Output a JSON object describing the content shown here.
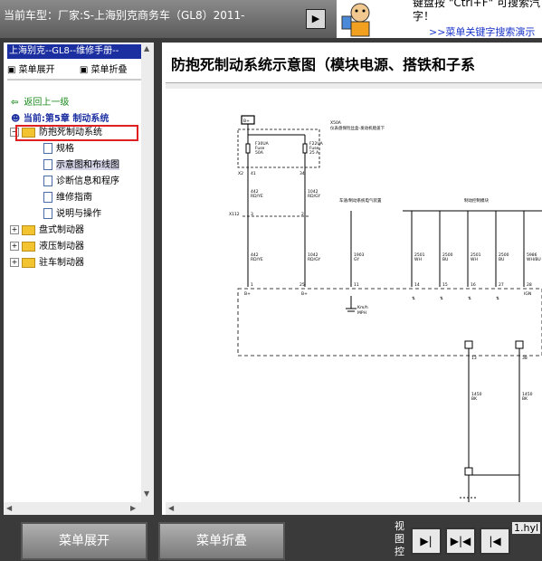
{
  "topbar": {
    "vehicle_label": "当前车型：厂家:S-上海别克商务车（GL8）2011-",
    "nav_button_icon": "play-arrow-icon",
    "ad_hint_line1": "键盘按 \"Ctrl+F\" 可搜索汽",
    "ad_hint_line2": "字！",
    "ad_link": ">>菜单关键字搜索演示"
  },
  "left_panel": {
    "title": "上海别克--GL8--维修手册--",
    "expand_menu": "菜单展开",
    "collapse_menu": "菜单折叠",
    "back_label": "返回上一级",
    "current_label": "当前:第5章  制动系统",
    "tree": [
      {
        "label": "防抱死制动系统",
        "type": "folder",
        "expanded": true
      },
      {
        "label": "规格",
        "type": "doc"
      },
      {
        "label": "示意图和布线图",
        "type": "doc",
        "selected": true
      },
      {
        "label": "诊断信息和程序",
        "type": "doc"
      },
      {
        "label": "维修指南",
        "type": "doc"
      },
      {
        "label": "说明与操作",
        "type": "doc"
      },
      {
        "label": "盘式制动器",
        "type": "folder"
      },
      {
        "label": "液压制动器",
        "type": "folder"
      },
      {
        "label": "驻车制动器",
        "type": "folder"
      }
    ]
  },
  "diagram": {
    "title": "防抱死制动系统示意图（模块电源、搭铁和子系",
    "labels": {
      "bplus": "B+",
      "x50a": "X50A",
      "fuse_block": "仪表盘保险丝盒-发动机舱盖下",
      "f30ua": "F30UA",
      "fuse1": "Fuse",
      "amp1": "50A",
      "f22ua": "F22UA",
      "fuse2": "Fuse",
      "amp2": "25 A",
      "x2": "X2",
      "p41": "41",
      "p34": "34",
      "w442": "442",
      "rdye": "RD/YE",
      "w1042": "1042",
      "rdgy": "RD/GY",
      "x112": "X112",
      "p3": "3",
      "p2": "2",
      "speed_sensor": "车速/制动系统电气装置",
      "module": "制动控制模块",
      "w1903": "1903",
      "gy": "GY",
      "w2501": "2501",
      "wh": "WH",
      "w2500": "2500",
      "bu": "BU",
      "w2501b": "2501",
      "whb": "WH",
      "w2500b": "2500",
      "bub": "BU",
      "w5986": "5986",
      "whbu": "WH/BU",
      "pin1": "1",
      "pin25": "25",
      "pin11": "11",
      "pin14": "14",
      "pin15": "15",
      "pin16": "16",
      "pin27": "27",
      "pin28": "28",
      "bplus2": "B+",
      "bplus3": "B+",
      "ign": "IGN",
      "kmh": "Km/h",
      "mph": "MPH",
      "pin13": "13",
      "pin38": "38",
      "w1450a": "1450",
      "bka": "BK",
      "w1450b": "1450",
      "bkb": "BK"
    }
  },
  "bottom_bar": {
    "expand_menu_button": "菜单展开",
    "collapse_menu_button": "菜单折叠",
    "view_label": "视图控",
    "view_buttons": [
      "play-right-icon",
      "fit-width-icon",
      "play-left-icon"
    ],
    "file_label": "1.hyl"
  },
  "colors": {
    "topbar": "#6a6a6a",
    "tree_title_bg": "#1c2fa0",
    "highlight_box": "#e02020",
    "link": "#1a34c9",
    "back_link": "#1c8a1c"
  }
}
